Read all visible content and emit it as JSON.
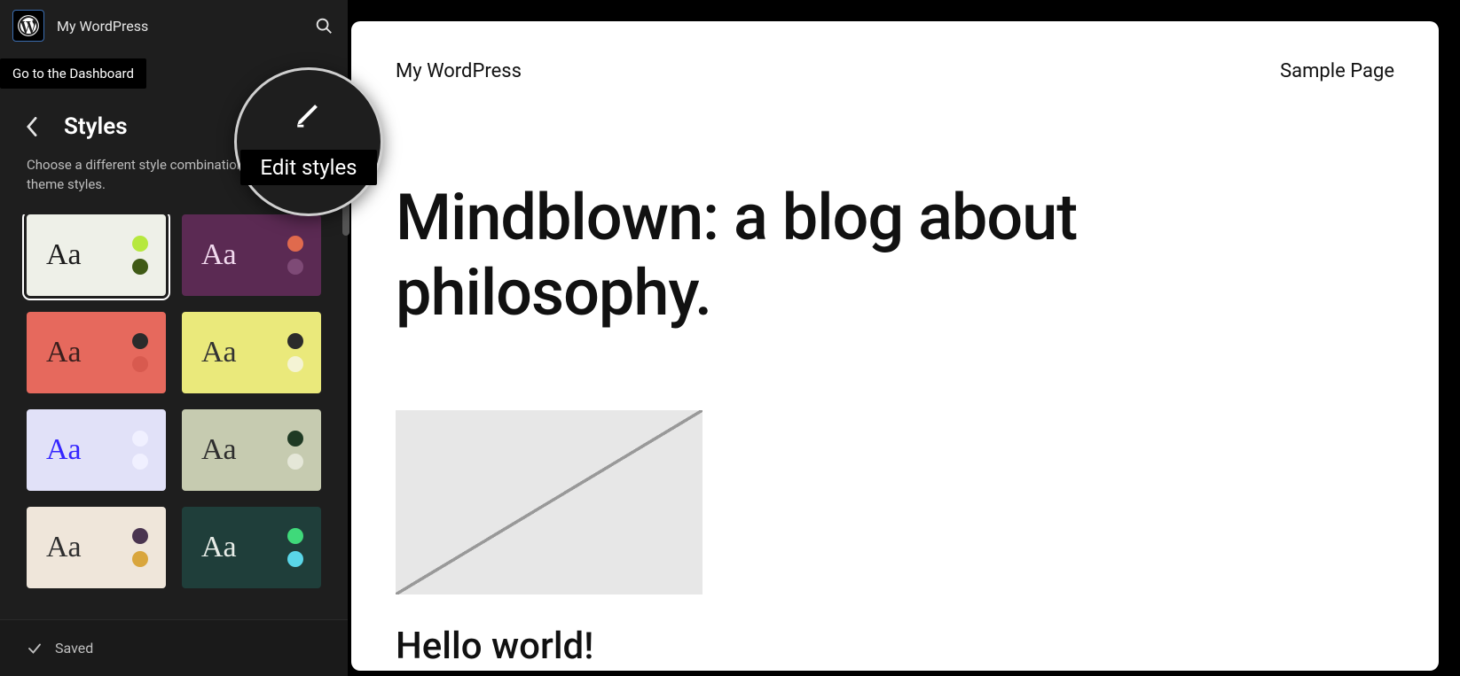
{
  "header": {
    "site_title": "My WordPress",
    "dashboard_tooltip": "Go to the Dashboard"
  },
  "panel": {
    "back_icon": "chevron-left",
    "title": "Styles",
    "description": "Choose a different style combination for the theme styles."
  },
  "swatches": [
    {
      "bg": "#eef0e8",
      "text": "#1c1c1c",
      "dot1": "#b6e83e",
      "dot2": "#3f5a16",
      "selected": true
    },
    {
      "bg": "#5b2a53",
      "text": "#f1d9ee",
      "dot1": "#e06a4d",
      "dot2": "#7e4a76",
      "selected": false
    },
    {
      "bg": "#e6695d",
      "text": "#3a1f1d",
      "dot1": "#2b2b2b",
      "dot2": "#d85a4f",
      "selected": false
    },
    {
      "bg": "#eae97b",
      "text": "#333",
      "dot1": "#2b2b2b",
      "dot2": "#f4f3d4",
      "selected": false
    },
    {
      "bg": "#e1e1f8",
      "text": "#3526ff",
      "dot1": "#f0f0ff",
      "dot2": "#f0f0ff",
      "selected": false
    },
    {
      "bg": "#c6cbb0",
      "text": "#2e2e2e",
      "dot1": "#1f3a24",
      "dot2": "#e5e7d8",
      "selected": false
    },
    {
      "bg": "#efe6da",
      "text": "#2e2e2e",
      "dot1": "#4a3550",
      "dot2": "#d9a63d",
      "selected": false
    },
    {
      "bg": "#1f3e3a",
      "text": "#e7ece7",
      "dot1": "#3fd97a",
      "dot2": "#5ad6e8",
      "selected": false
    }
  ],
  "footer": {
    "status": "Saved"
  },
  "lens": {
    "label": "Edit styles"
  },
  "canvas": {
    "site_brand": "My WordPress",
    "nav_link": "Sample Page",
    "hero": "Mindblown: a blog about philosophy.",
    "post_title": "Hello world!"
  }
}
